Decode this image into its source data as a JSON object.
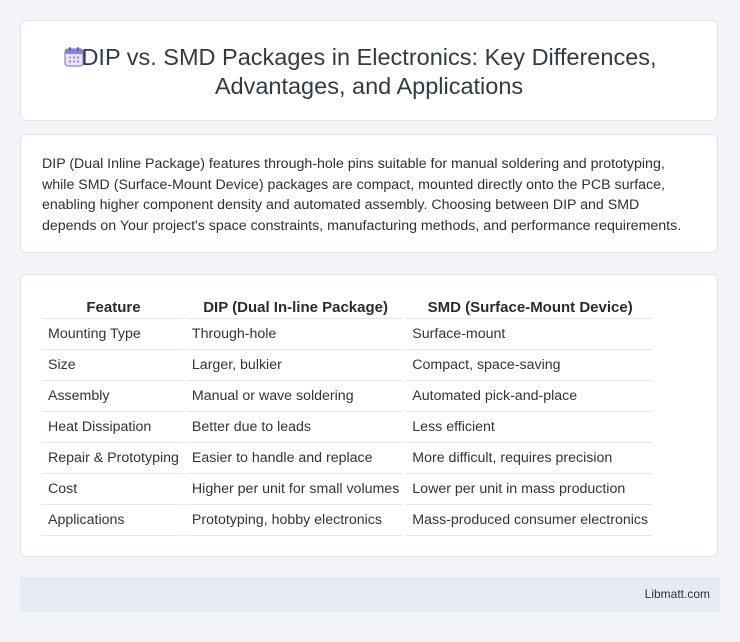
{
  "header": {
    "icon": "calendar-icon",
    "title_line1": "DIP vs. SMD Packages in Electronics: Key Differences,",
    "title_line2": "Advantages, and Applications"
  },
  "description": "DIP (Dual Inline Package) features through-hole pins suitable for manual soldering and prototyping, while SMD (Surface-Mount Device) packages are compact, mounted directly onto the PCB surface, enabling higher component density and automated assembly. Choosing between DIP and SMD depends on Your project's space constraints, manufacturing methods, and performance requirements.",
  "table": {
    "headers": [
      "Feature",
      "DIP (Dual In-line Package)",
      "SMD (Surface-Mount Device)"
    ],
    "rows": [
      [
        "Mounting Type",
        "Through-hole",
        "Surface-mount"
      ],
      [
        "Size",
        "Larger, bulkier",
        "Compact, space-saving"
      ],
      [
        "Assembly",
        "Manual or wave soldering",
        "Automated pick-and-place"
      ],
      [
        "Heat Dissipation",
        "Better due to leads",
        "Less efficient"
      ],
      [
        "Repair & Prototyping",
        "Easier to handle and replace",
        "More difficult, requires precision"
      ],
      [
        "Cost",
        "Higher per unit for small volumes",
        "Lower per unit in mass production"
      ],
      [
        "Applications",
        "Prototyping, hobby electronics",
        "Mass-produced consumer electronics"
      ]
    ]
  },
  "footer": {
    "site": "Libmatt.com"
  },
  "colors": {
    "background": "#f3f4f8",
    "card": "#ffffff",
    "footer": "#e6eaf4",
    "icon_accent": "#7c6fd6"
  }
}
